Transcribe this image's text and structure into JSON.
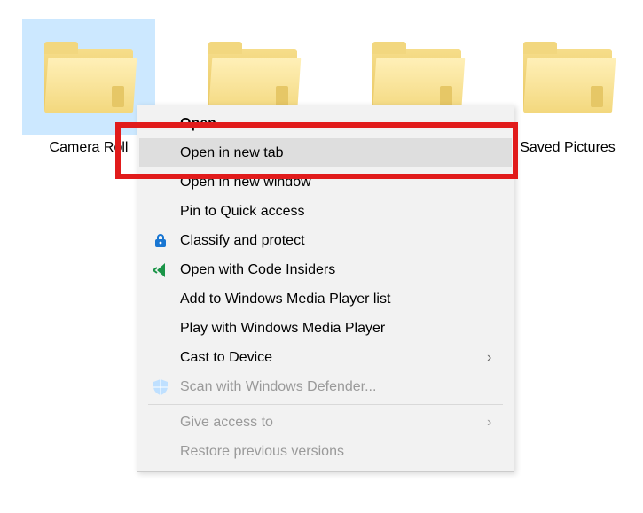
{
  "folders": [
    {
      "name": "Camera Roll",
      "selected": true
    },
    {
      "name": ""
    },
    {
      "name": ""
    },
    {
      "name": "Saved Pictures"
    }
  ],
  "menu": [
    {
      "label": "Open",
      "bold": true
    },
    {
      "label": "Open in new tab",
      "hovered": true
    },
    {
      "label": "Open in new window"
    },
    {
      "label": "Pin to Quick access"
    },
    {
      "label": "Classify and protect",
      "icon": "lock-icon"
    },
    {
      "label": "Open with Code Insiders",
      "icon": "vscode-insiders-icon"
    },
    {
      "label": "Add to Windows Media Player list"
    },
    {
      "label": "Play with Windows Media Player"
    },
    {
      "label": "Cast to Device",
      "submenu": true
    },
    {
      "label": "Scan with Windows Defender...",
      "icon": "shield-icon",
      "disabled": true
    },
    {
      "label": "Give access to",
      "submenu": true,
      "disabled": true
    },
    {
      "label": "Restore previous versions",
      "disabled": true
    }
  ],
  "colors": {
    "selection": "#cce8ff",
    "hover": "#dedede",
    "menu_bg": "#f2f2f2",
    "callout": "#e11b1b",
    "folder_light": "#fff0b8",
    "folder_dark": "#e8c660"
  }
}
